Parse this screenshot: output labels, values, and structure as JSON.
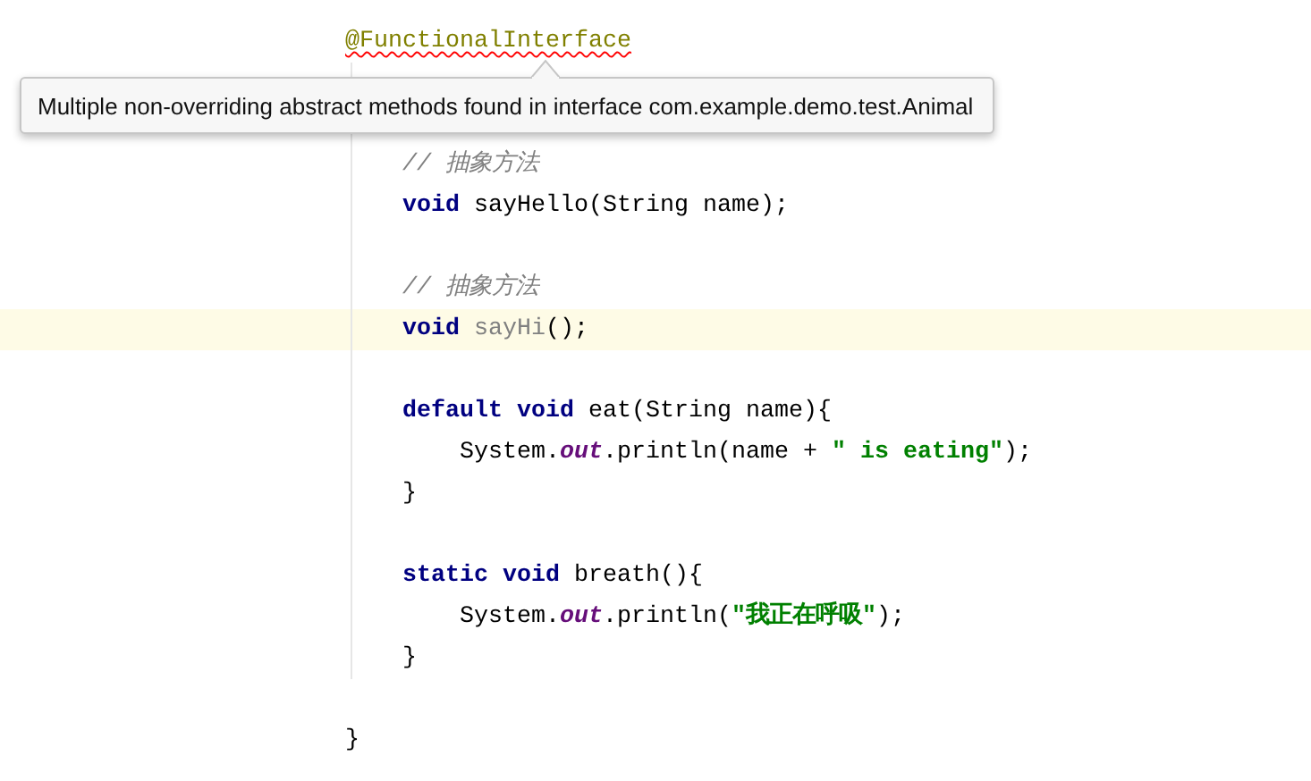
{
  "editor": {
    "lines": [
      {
        "kind": "code",
        "current": false,
        "tokens": [
          {
            "kind": "annotation",
            "text": "@FunctionalInterface",
            "error": true
          }
        ]
      },
      {
        "kind": "blank"
      },
      {
        "kind": "blank"
      },
      {
        "kind": "code",
        "current": false,
        "tokens": [
          {
            "kind": "comment",
            "text": "    // 抽象方法"
          }
        ]
      },
      {
        "kind": "code",
        "current": false,
        "tokens": [
          {
            "kind": "keyword",
            "text": "    void"
          },
          {
            "kind": "plain",
            "text": " sayHello(String name);"
          }
        ]
      },
      {
        "kind": "blank"
      },
      {
        "kind": "code",
        "current": false,
        "tokens": [
          {
            "kind": "comment",
            "text": "    // 抽象方法"
          }
        ]
      },
      {
        "kind": "code",
        "current": true,
        "tokens": [
          {
            "kind": "keyword",
            "text": "    void "
          },
          {
            "kind": "unused",
            "text": "sayHi"
          },
          {
            "kind": "plain",
            "text": "();"
          }
        ]
      },
      {
        "kind": "blank"
      },
      {
        "kind": "code",
        "current": false,
        "tokens": [
          {
            "kind": "keyword",
            "text": "    default void"
          },
          {
            "kind": "plain",
            "text": " eat(String name){"
          }
        ]
      },
      {
        "kind": "code",
        "current": false,
        "tokens": [
          {
            "kind": "plain",
            "text": "        System."
          },
          {
            "kind": "field",
            "text": "out"
          },
          {
            "kind": "plain",
            "text": ".println(name + "
          },
          {
            "kind": "string",
            "text": "\" is eating\""
          },
          {
            "kind": "plain",
            "text": ");"
          }
        ]
      },
      {
        "kind": "code",
        "current": false,
        "tokens": [
          {
            "kind": "plain",
            "text": "    }"
          }
        ]
      },
      {
        "kind": "blank"
      },
      {
        "kind": "code",
        "current": false,
        "tokens": [
          {
            "kind": "keyword",
            "text": "    static void"
          },
          {
            "kind": "plain",
            "text": " breath(){"
          }
        ]
      },
      {
        "kind": "code",
        "current": false,
        "tokens": [
          {
            "kind": "plain",
            "text": "        System."
          },
          {
            "kind": "field",
            "text": "out"
          },
          {
            "kind": "plain",
            "text": ".println("
          },
          {
            "kind": "string",
            "text": "\"我正在呼吸\""
          },
          {
            "kind": "plain",
            "text": ");"
          }
        ]
      },
      {
        "kind": "code",
        "current": false,
        "tokens": [
          {
            "kind": "plain",
            "text": "    }"
          }
        ]
      },
      {
        "kind": "blank"
      },
      {
        "kind": "code",
        "current": false,
        "tokens": [
          {
            "kind": "plain",
            "text": "}"
          }
        ]
      }
    ]
  },
  "tooltip": {
    "text": "Multiple non-overriding abstract methods found in interface com.example.demo.test.Animal"
  }
}
